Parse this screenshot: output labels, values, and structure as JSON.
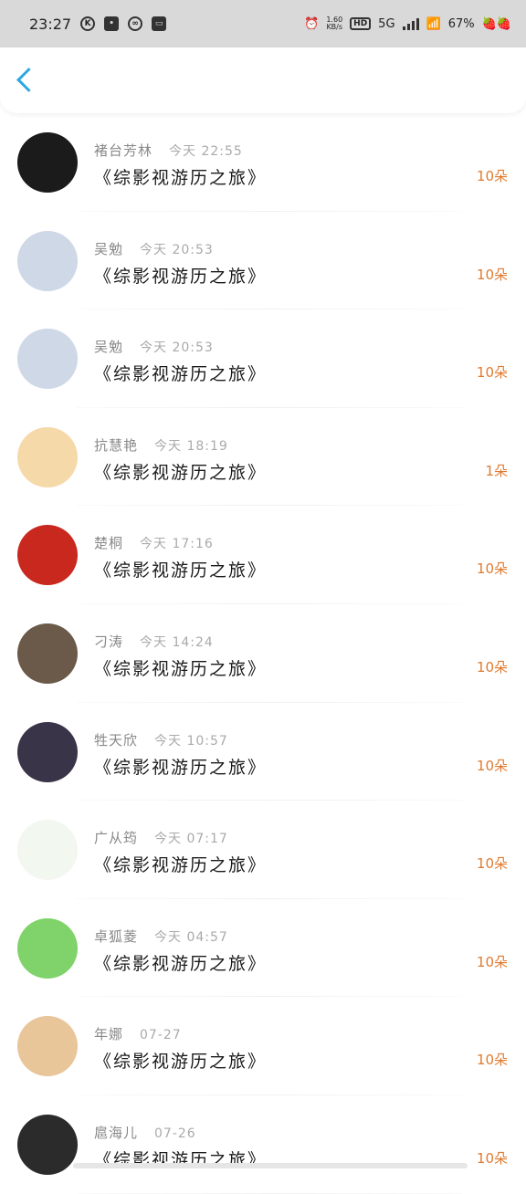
{
  "status": {
    "time": "23:27",
    "net_speed": "1.60\nKB/s",
    "hd": "HD",
    "network": "5G",
    "battery": "67%"
  },
  "items": [
    {
      "name": "褚台芳林",
      "time": "今天 22:55",
      "title": "《综影视游历之旅》",
      "amount": "10朵",
      "avatar_color": "#1b1b1b",
      "avatar": "dragon-emblem-avatar"
    },
    {
      "name": "吴勉",
      "time": "今天 20:53",
      "title": "《综影视游历之旅》",
      "amount": "10朵",
      "avatar_color": "#cfd8e6",
      "avatar": "anime-character-avatar"
    },
    {
      "name": "吴勉",
      "time": "今天 20:53",
      "title": "《综影视游历之旅》",
      "amount": "10朵",
      "avatar_color": "#cfd8e6",
      "avatar": "anime-character-avatar"
    },
    {
      "name": "抗慧艳",
      "time": "今天 18:19",
      "title": "《综影视游历之旅》",
      "amount": "1朵",
      "avatar_color": "#f6d9a8",
      "avatar": "hamster-avatar"
    },
    {
      "name": "楚桐",
      "time": "今天 17:16",
      "title": "《综影视游历之旅》",
      "amount": "10朵",
      "avatar_color": "#c8281e",
      "avatar": "red-costume-avatar"
    },
    {
      "name": "刁涛",
      "time": "今天 14:24",
      "title": "《综影视游历之旅》",
      "amount": "10朵",
      "avatar_color": "#6b5a4a",
      "avatar": "portrait-avatar"
    },
    {
      "name": "牲天欣",
      "time": "今天 10:57",
      "title": "《综影视游历之旅》",
      "amount": "10朵",
      "avatar_color": "#3a3448",
      "avatar": "camera-girl-avatar"
    },
    {
      "name": "广从筠",
      "time": "今天 07:17",
      "title": "《综影视游历之旅》",
      "amount": "10朵",
      "avatar_color": "#f2f7ef",
      "avatar": "sprout-avatar"
    },
    {
      "name": "卓狐菱",
      "time": "今天 04:57",
      "title": "《综影视游历之旅》",
      "amount": "10朵",
      "avatar_color": "#7fd36a",
      "avatar": "green-shirt-avatar"
    },
    {
      "name": "年娜",
      "time": "07-27",
      "title": "《综影视游历之旅》",
      "amount": "10朵",
      "avatar_color": "#e9c59a",
      "avatar": "warm-photo-avatar"
    },
    {
      "name": "扈海儿",
      "time": "07-26",
      "title": "《综影视游历之旅》",
      "amount": "10朵",
      "avatar_color": "#2b2b2b",
      "avatar": "couple-photo-avatar"
    }
  ],
  "colors": {
    "accent": "#2aa8e0",
    "amount": "#e07a2e"
  }
}
